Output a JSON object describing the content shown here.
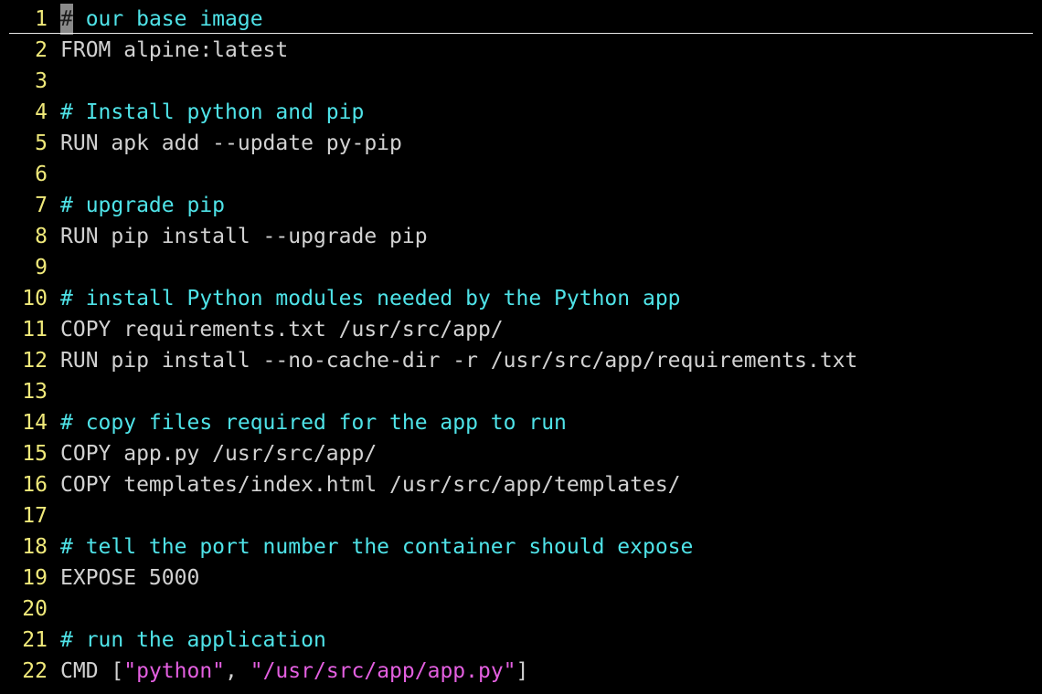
{
  "editor": {
    "lines": [
      {
        "num": "1",
        "tokens": [
          {
            "type": "cursor",
            "text": "#"
          },
          {
            "type": "comment",
            "text": " our base image"
          }
        ]
      },
      {
        "num": "2",
        "tokens": [
          {
            "type": "plain",
            "text": "FROM alpine:latest"
          }
        ]
      },
      {
        "num": "3",
        "tokens": []
      },
      {
        "num": "4",
        "tokens": [
          {
            "type": "comment",
            "text": "# Install python and pip"
          }
        ]
      },
      {
        "num": "5",
        "tokens": [
          {
            "type": "plain",
            "text": "RUN apk add --update py-pip"
          }
        ]
      },
      {
        "num": "6",
        "tokens": []
      },
      {
        "num": "7",
        "tokens": [
          {
            "type": "comment",
            "text": "# upgrade pip"
          }
        ]
      },
      {
        "num": "8",
        "tokens": [
          {
            "type": "plain",
            "text": "RUN pip install --upgrade pip"
          }
        ]
      },
      {
        "num": "9",
        "tokens": []
      },
      {
        "num": "10",
        "tokens": [
          {
            "type": "comment",
            "text": "# install Python modules needed by the Python app"
          }
        ]
      },
      {
        "num": "11",
        "tokens": [
          {
            "type": "plain",
            "text": "COPY requirements.txt /usr/src/app/"
          }
        ]
      },
      {
        "num": "12",
        "tokens": [
          {
            "type": "plain",
            "text": "RUN pip install --no-cache-dir -r /usr/src/app/requirements.txt"
          }
        ]
      },
      {
        "num": "13",
        "tokens": []
      },
      {
        "num": "14",
        "tokens": [
          {
            "type": "comment",
            "text": "# copy files required for the app to run"
          }
        ]
      },
      {
        "num": "15",
        "tokens": [
          {
            "type": "plain",
            "text": "COPY app.py /usr/src/app/"
          }
        ]
      },
      {
        "num": "16",
        "tokens": [
          {
            "type": "plain",
            "text": "COPY templates/index.html /usr/src/app/templates/"
          }
        ]
      },
      {
        "num": "17",
        "tokens": []
      },
      {
        "num": "18",
        "tokens": [
          {
            "type": "comment",
            "text": "# tell the port number the container should expose"
          }
        ]
      },
      {
        "num": "19",
        "tokens": [
          {
            "type": "plain",
            "text": "EXPOSE 5000"
          }
        ]
      },
      {
        "num": "20",
        "tokens": []
      },
      {
        "num": "21",
        "tokens": [
          {
            "type": "comment",
            "text": "# run the application"
          }
        ]
      },
      {
        "num": "22",
        "tokens": [
          {
            "type": "plain",
            "text": "CMD ["
          },
          {
            "type": "string",
            "text": "\"python\""
          },
          {
            "type": "plain",
            "text": ", "
          },
          {
            "type": "string",
            "text": "\"/usr/src/app/app.py\""
          },
          {
            "type": "plain",
            "text": "]"
          }
        ]
      }
    ]
  },
  "colors": {
    "background": "#000000",
    "line_number": "#f0e97a",
    "comment": "#4fe3e8",
    "string": "#e35fe0",
    "plain": "#d2d2d2",
    "cursor": "#8a8a8a"
  }
}
